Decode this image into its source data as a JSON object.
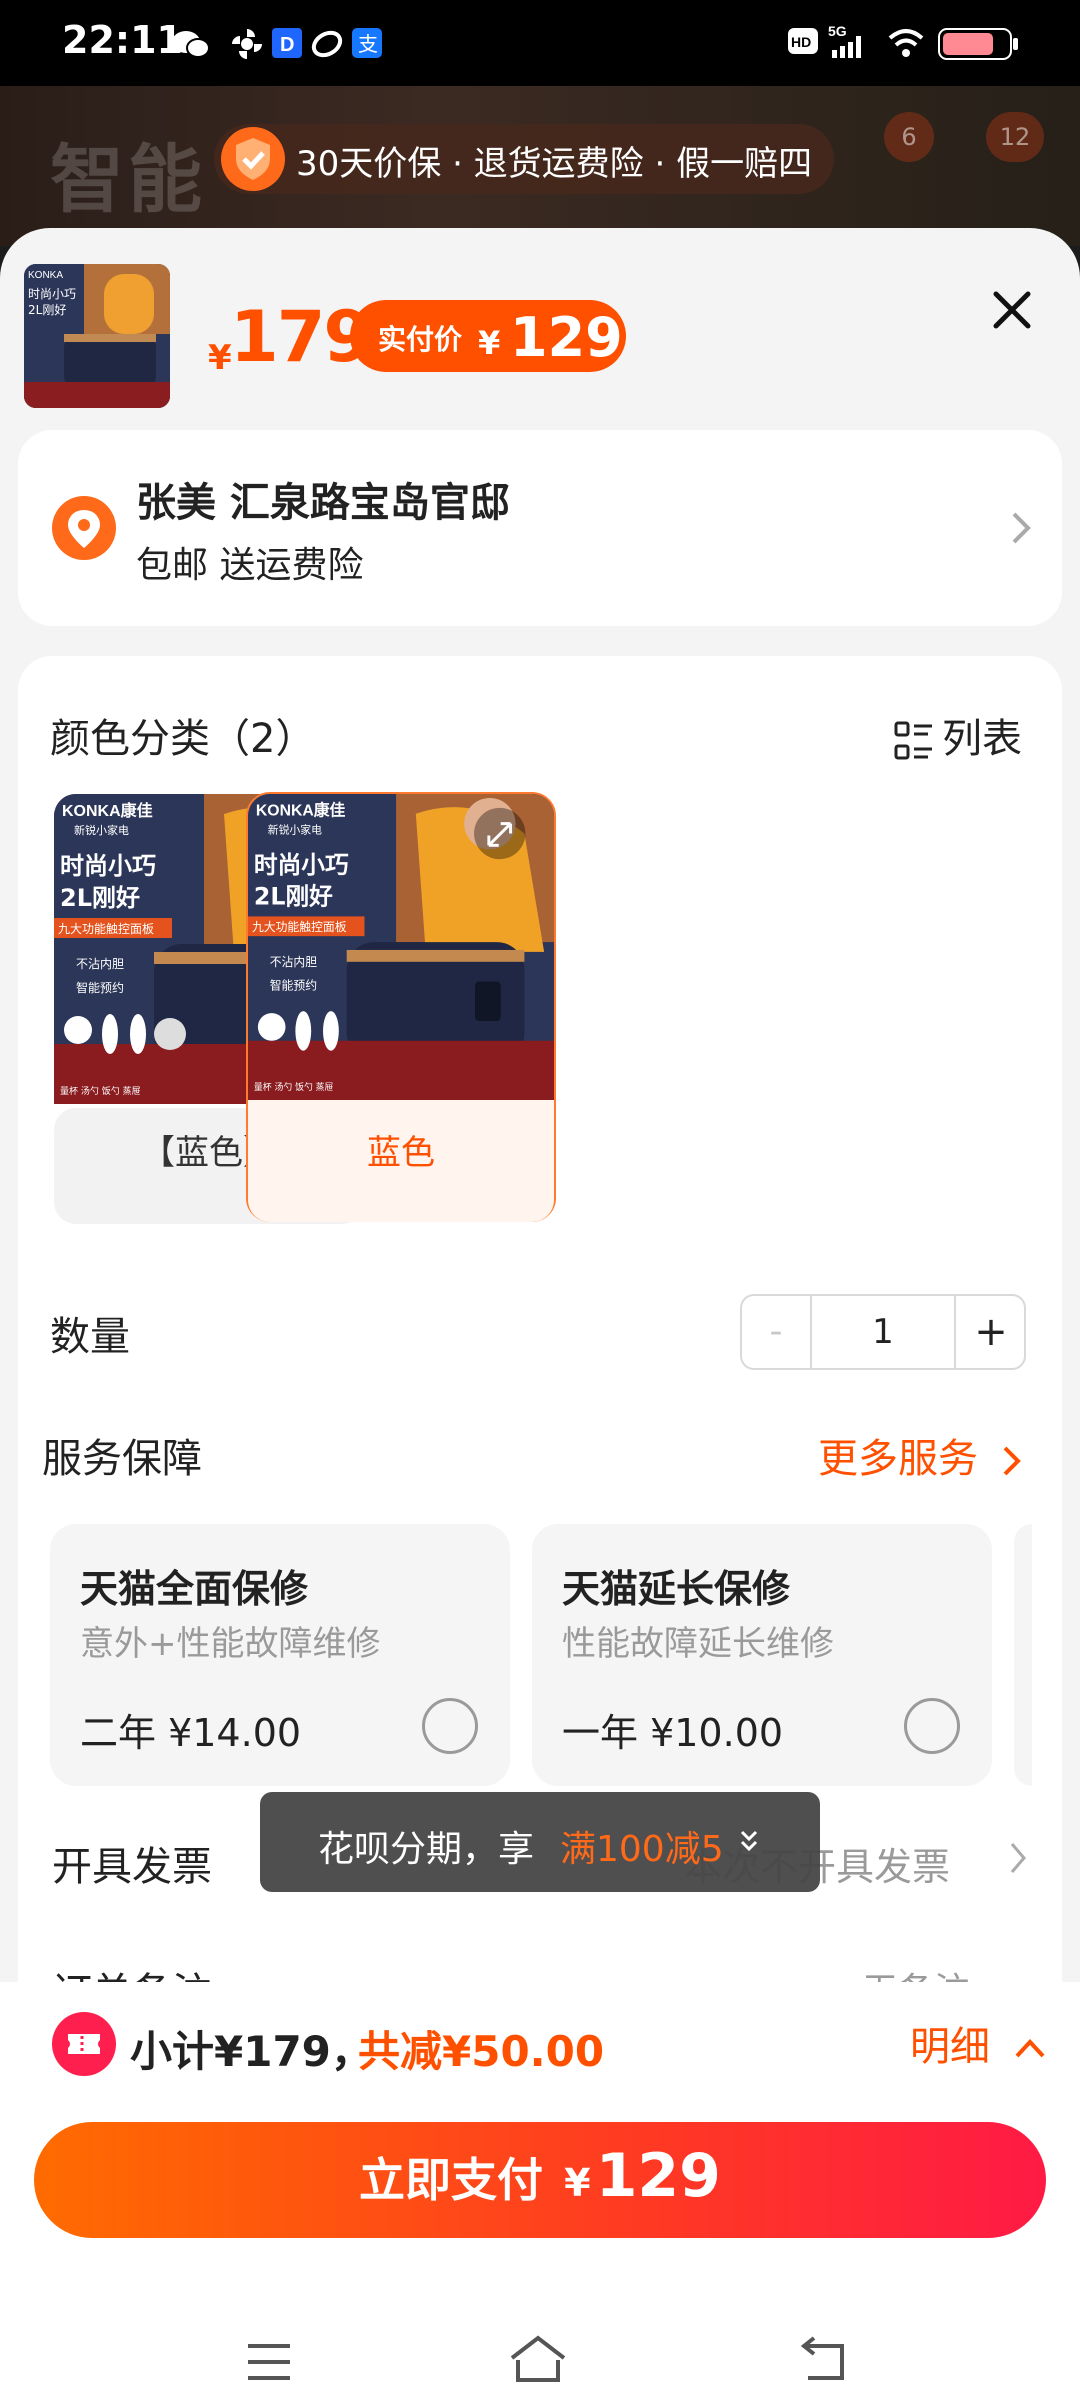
{
  "status_bar": {
    "time": "22:11",
    "icons": [
      "wechat-icon",
      "pinwheel-icon",
      "d-app-icon",
      "link-app-icon",
      "alipay-icon",
      "hd-icon",
      "signal-5g-icon",
      "wifi-icon",
      "battery-icon"
    ]
  },
  "background": {
    "title": "智能",
    "promo": "30天价保 · 退货运费险 · 假一赔四",
    "badge_left": "6",
    "badge_right": "12"
  },
  "sheet": {
    "price": {
      "currency": "¥",
      "value": "179"
    },
    "actual": {
      "label": "实付价",
      "currency": "¥",
      "value": "129"
    },
    "close_icon": "close-icon",
    "address": {
      "name_line": "张美 汇泉路宝岛官邸",
      "shipping": "包邮 送运费险"
    },
    "color": {
      "title": "颜色分类（2）",
      "list_label": "列表",
      "options": [
        {
          "label": "【蓝色】",
          "selected": false
        },
        {
          "label": "蓝色",
          "selected": true
        }
      ],
      "product_image_text": {
        "brand": "KONKA康佳",
        "tagline": "新锐小家电",
        "headline1": "时尚小巧",
        "headline2": "2L刚好",
        "banner": "九大功能触控面板",
        "feature1": "不沾内胆",
        "feature2": "智能预约",
        "accessories": "量杯  汤勺  饭勺  蒸屉"
      }
    },
    "quantity": {
      "label": "数量",
      "minus": "-",
      "value": "1",
      "plus": "+"
    },
    "service": {
      "title": "服务保障",
      "more": "更多服务",
      "items": [
        {
          "title": "天猫全面保修",
          "desc": "意外+性能故障维修",
          "price": "二年 ¥14.00"
        },
        {
          "title": "天猫延长保修",
          "desc": "性能故障延长维修",
          "price": "一年 ¥10.00"
        }
      ]
    },
    "invoice": {
      "label": "开具发票",
      "value": "本次不开具发票"
    },
    "remark": {
      "label": "订单备注",
      "value": "无备注"
    },
    "toast": {
      "prefix": "花呗分期，享",
      "highlight": "满100减5"
    }
  },
  "footer": {
    "subtotal": "小计¥179，",
    "discount": "共减¥50.00",
    "detail": "明细",
    "pay_label": "立即支付",
    "pay_currency": "¥",
    "pay_value": "129"
  },
  "colors": {
    "accent": "#ff5000",
    "pay_gradient_end": "#ff1a45"
  }
}
